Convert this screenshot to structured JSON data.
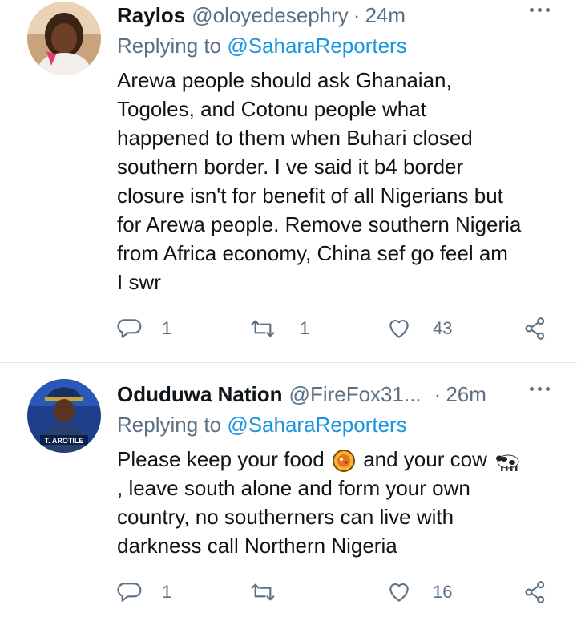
{
  "tweets": [
    {
      "name": "Raylos",
      "handle": "@oloyedesephry",
      "dot": "·",
      "time": "24m",
      "replying_prefix": "Replying to ",
      "replying_to": "@SaharaReporters",
      "lines": [
        "Arewa people should ask Ghanaian,",
        "Togoles, and Cotonu people what",
        "happened to them when Buhari closed",
        "southern border. I ve said it b4 border",
        "closure isn't for benefit of all Nigerians but",
        "for Arewa people. Remove southern Nigeria",
        "from Africa economy, China sef go feel am",
        "I swr"
      ],
      "reply_count": "1",
      "retweet_count": "1",
      "like_count": "43"
    },
    {
      "name": "Oduduwa Nation",
      "handle": "@FireFox31...",
      "dot": "·",
      "time": "26m",
      "replying_prefix": "Replying to ",
      "replying_to": "@SaharaReporters",
      "line1_a": "Please keep your food",
      "line1_b": "and your cow",
      "lines_rest": [
        ", leave south alone and form your own",
        "country, no southerners can live with",
        "darkness call Northern Nigeria"
      ],
      "avatar_text": "T. AROTILE",
      "reply_count": "1",
      "retweet_count": "",
      "like_count": "16"
    }
  ],
  "icons": {
    "reply": "reply-icon",
    "retweet": "retweet-icon",
    "like": "heart-icon",
    "share": "share-icon",
    "more": "more-icon",
    "food_emoji": "food-emoji-icon",
    "cow_emoji": "cow-emoji-icon"
  },
  "colors": {
    "text": "#0f1419",
    "secondary": "#5b7083",
    "mention": "#1b95e0",
    "divider": "#e1e6ea"
  }
}
